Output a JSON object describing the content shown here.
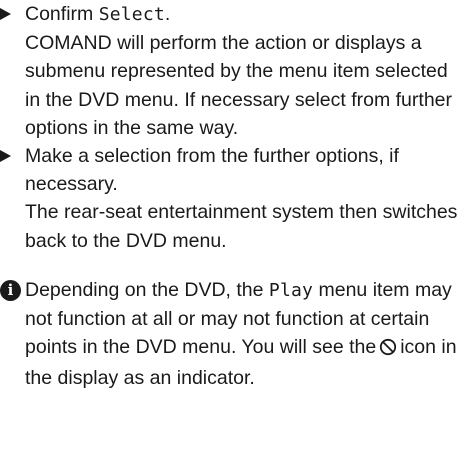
{
  "steps": [
    {
      "action_prefix": "Confirm ",
      "action_code": "Select",
      "action_suffix": ".",
      "result": "COMAND will perform the action or displays a submenu represented by the menu item selected in the DVD menu. If necessary select from further options in the same way."
    },
    {
      "action": "Make a selection from the further options, if necessary.",
      "result": "The rear-seat entertainment system then switches back to the DVD menu."
    }
  ],
  "note": {
    "icon": "info-icon",
    "icon_glyph": "i",
    "text_part1": "Depending on the DVD, the ",
    "code": "Play",
    "text_part2": " menu item may not function at all or may not function at certain points in the DVD menu. You will see the",
    "prohibited_icon": "prohibited-icon",
    "text_part3": "icon in the display as an indicator."
  },
  "colors": {
    "text": "#1a1a1a",
    "background": "#ffffff"
  }
}
